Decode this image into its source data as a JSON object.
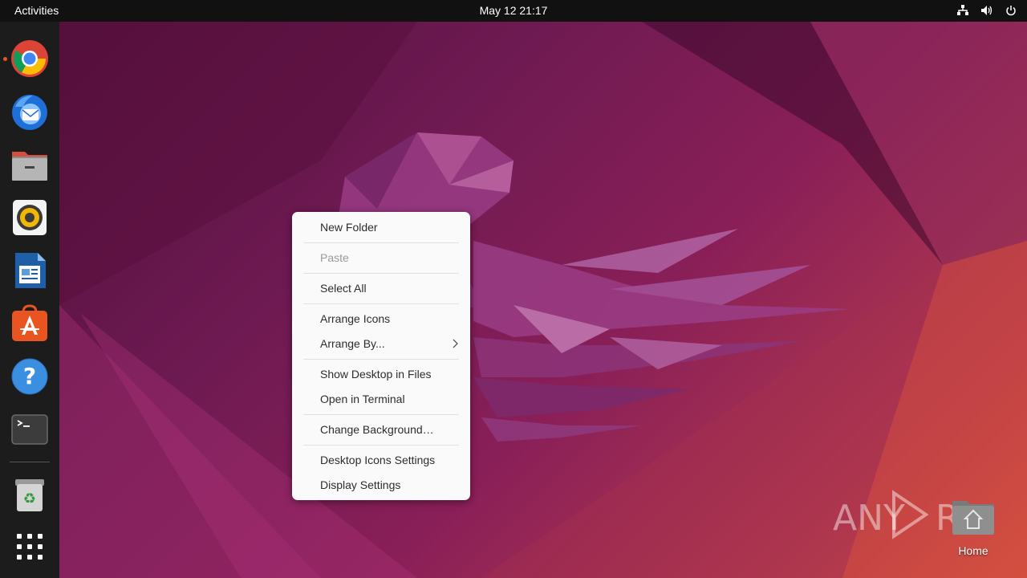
{
  "topbar": {
    "activities": "Activities",
    "clock": "May 12  21:17",
    "tray_icons": [
      "network-icon",
      "volume-icon",
      "power-icon"
    ]
  },
  "dock": {
    "apps": [
      {
        "name": "Google Chrome",
        "icon": "chrome-icon",
        "running": true
      },
      {
        "name": "Thunderbird Mail",
        "icon": "thunderbird-icon"
      },
      {
        "name": "Files",
        "icon": "files-icon"
      },
      {
        "name": "Rhythmbox",
        "icon": "rhythmbox-icon"
      },
      {
        "name": "LibreOffice Writer",
        "icon": "writer-icon"
      },
      {
        "name": "Ubuntu Software",
        "icon": "software-icon"
      },
      {
        "name": "Help",
        "icon": "help-icon"
      },
      {
        "name": "Terminal",
        "icon": "terminal-icon"
      },
      {
        "name": "Trash",
        "icon": "trash-icon"
      },
      {
        "name": "Show Applications",
        "icon": "app-grid-icon"
      }
    ]
  },
  "context_menu": {
    "items": [
      {
        "label": "New Folder"
      },
      {
        "label": "Paste",
        "disabled": true
      },
      {
        "label": "Select All"
      },
      {
        "label": "Arrange Icons"
      },
      {
        "label": "Arrange By...",
        "submenu": true
      },
      {
        "label": "Show Desktop in Files"
      },
      {
        "label": "Open in Terminal"
      },
      {
        "label": "Change Background…"
      },
      {
        "label": "Desktop Icons Settings"
      },
      {
        "label": "Display Settings"
      }
    ]
  },
  "desktop": {
    "home_label": "Home"
  },
  "watermark": {
    "text_left": "ANY",
    "text_right": "RUN"
  },
  "colors": {
    "accent": "#e95420",
    "topbar": "#111111",
    "dock": "#1c1c1c",
    "menu_bg": "#fafafa"
  }
}
